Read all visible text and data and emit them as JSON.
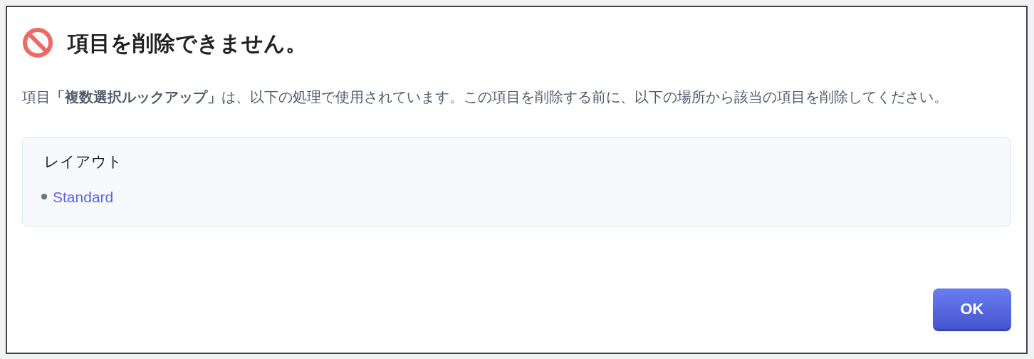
{
  "dialog": {
    "title": "項目を削除できません。",
    "message": "項目**「複数選択ルックアップ」**は、以下の処理で使用されています。この項目を削除する前に、以下の場所から該当の項目を削除してください。",
    "usages": [
      {
        "heading": "レイアウト",
        "items": [
          "Standard"
        ]
      }
    ],
    "buttons": [
      "OK"
    ]
  }
}
